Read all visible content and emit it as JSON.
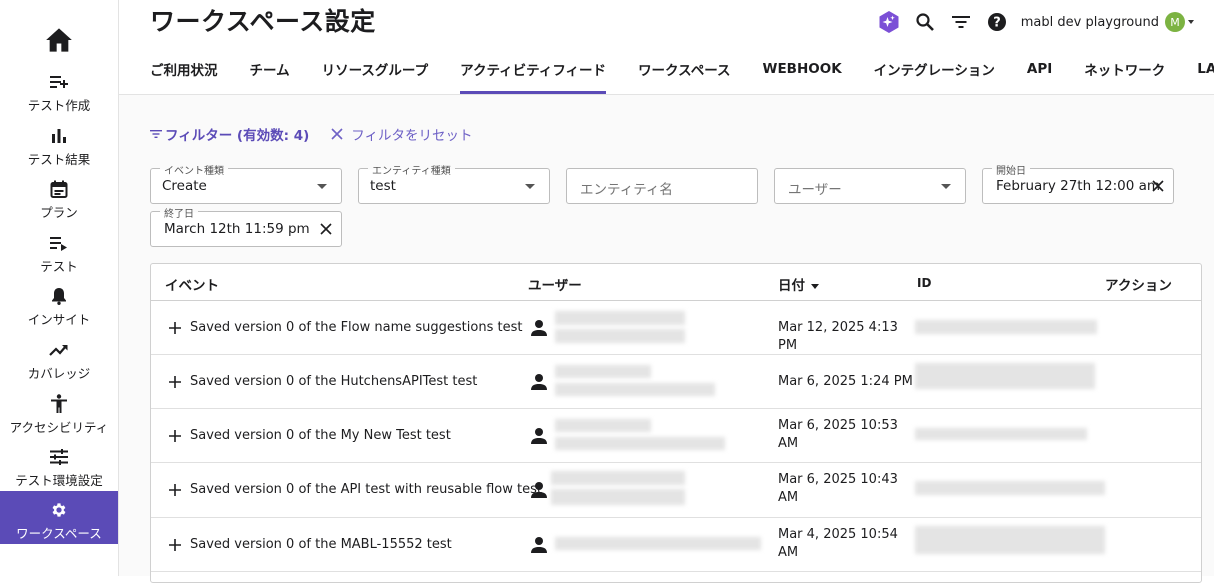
{
  "sidebar": {
    "home_icon": "home-icon",
    "items": [
      {
        "label": "テスト作成",
        "icon": "playlist-add-icon",
        "active": false
      },
      {
        "label": "テスト結果",
        "icon": "bar-chart-icon",
        "active": false
      },
      {
        "label": "プラン",
        "icon": "calendar-icon",
        "active": false
      },
      {
        "label": "テスト",
        "icon": "playlist-play-icon",
        "active": false
      },
      {
        "label": "インサイト",
        "icon": "bell-icon",
        "active": false
      },
      {
        "label": "カバレッジ",
        "icon": "trending-up-icon",
        "active": false
      },
      {
        "label": "アクセシビリティ",
        "icon": "accessibility-icon",
        "active": false
      },
      {
        "label": "テスト環境設定",
        "icon": "tune-icon",
        "active": false
      },
      {
        "label": "ワークスペース",
        "icon": "gear-icon",
        "active": true
      }
    ]
  },
  "header": {
    "title": "ワークスペース設定",
    "workspace_name": "mabl dev playground",
    "avatar_initial": "M"
  },
  "tabs": [
    {
      "label": "ご利用状況"
    },
    {
      "label": "チーム"
    },
    {
      "label": "リソースグループ"
    },
    {
      "label": "アクティビティフィード",
      "active": true
    },
    {
      "label": "ワークスペース"
    },
    {
      "label": "WEBHOOK"
    },
    {
      "label": "インテグレーション"
    },
    {
      "label": "API"
    },
    {
      "label": "ネットワーク"
    },
    {
      "label": "LABS"
    }
  ],
  "filters": {
    "filter_button": "フィルター (有効数: 4)",
    "reset_button": "フィルタをリセット",
    "event_type": {
      "label": "イベント種類",
      "value": "Create"
    },
    "entity_type": {
      "label": "エンティティ種類",
      "value": "test"
    },
    "entity_name": {
      "placeholder": "エンティティ名"
    },
    "user": {
      "placeholder": "ユーザー"
    },
    "start_date": {
      "label": "開始日",
      "value": "February 27th 12:00 am"
    },
    "end_date": {
      "label": "終了日",
      "value": "March 12th 11:59 pm"
    }
  },
  "table": {
    "columns": {
      "event": "イベント",
      "user": "ユーザー",
      "date": "日付",
      "id": "ID",
      "action": "アクション"
    },
    "rows": [
      {
        "event": "Saved version 0 of the Flow name suggestions test",
        "date": "Mar 12, 2025 4:13 PM"
      },
      {
        "event": "Saved version 0 of the HutchensAPITest test",
        "date": "Mar 6, 2025 1:24 PM"
      },
      {
        "event": "Saved version 0 of the My New Test test",
        "date": "Mar 6, 2025 10:53 AM"
      },
      {
        "event": "Saved version 0 of the API test with reusable flow test",
        "date": "Mar 6, 2025 10:43 AM"
      },
      {
        "event": "Saved version 0 of the MABL-15552 test",
        "date": "Mar 4, 2025 10:54 AM"
      }
    ]
  },
  "colors": {
    "accent": "#5b4bb7",
    "avatar": "#7cb342"
  }
}
